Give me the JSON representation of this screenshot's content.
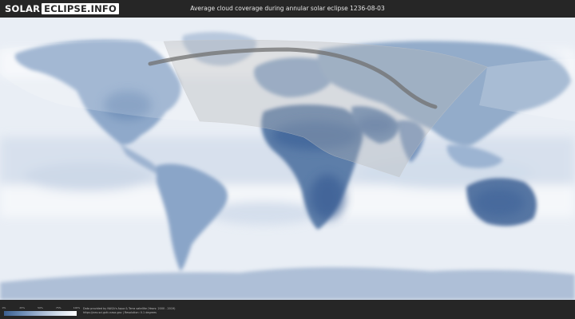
{
  "header": {
    "logo_solar": "SOLAR",
    "logo_eclipse": "ECLIPSE.INFO",
    "title": "Average cloud coverage during annular solar eclipse 1236-08-03"
  },
  "legend": {
    "ticks": [
      "0%",
      "25%",
      "50%",
      "75%",
      "100%"
    ],
    "colors": [
      "#3c5f8f",
      "#6c8cb5",
      "#a3b7d2",
      "#d5e0ec",
      "#ffffff"
    ]
  },
  "footer": {
    "credit_line1": "Data provided by NASA's Aqua & Terra satellite (Years: 2000 - 2019)",
    "credit_line2": "https://neo.sci.gsfc.nasa.gov | Resolution: 0.1 degrees"
  },
  "map": {
    "ocean_color": "#e9eef5",
    "land_color": "#7f9cc2",
    "dense_land_color": "#4e6f9c",
    "eclipse_path_color": "#707070",
    "visibility_zone_color": "#b8b8b8",
    "eclipse_type": "annular",
    "eclipse_date": "1236-08-03"
  }
}
